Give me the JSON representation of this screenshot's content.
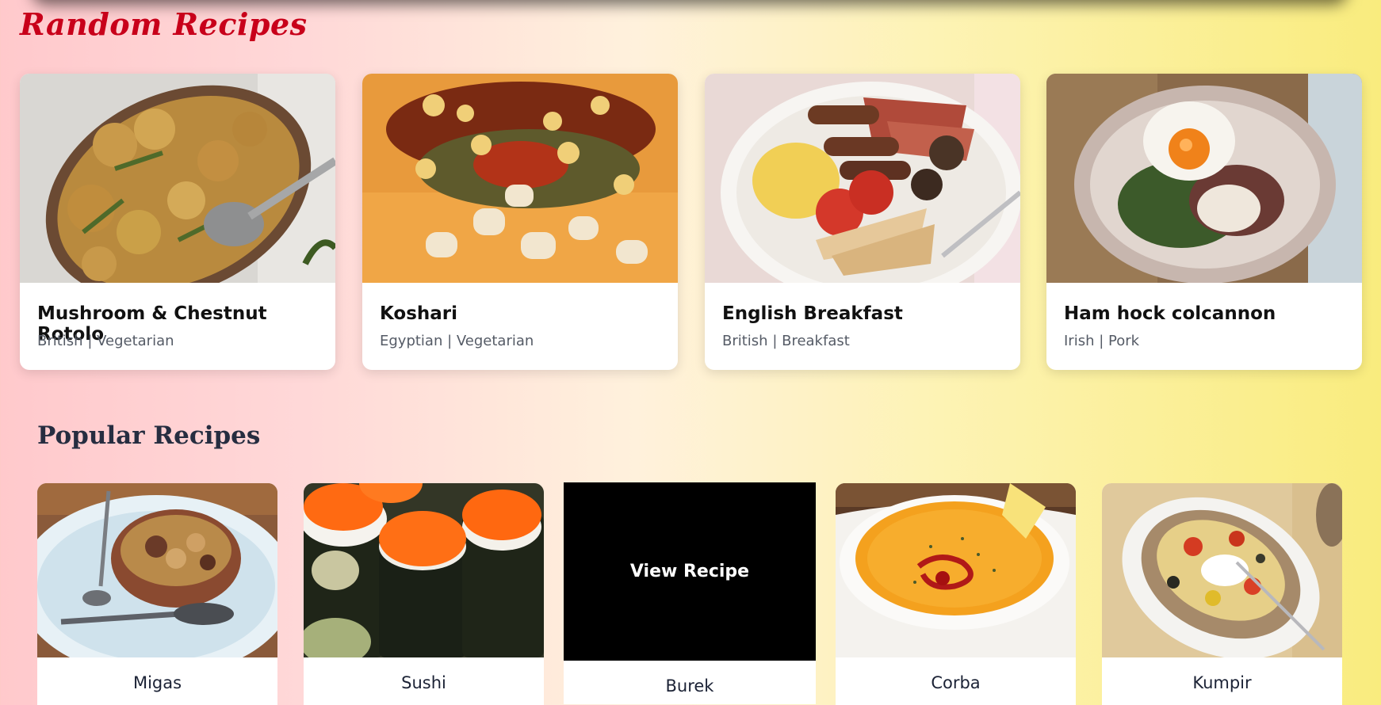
{
  "random": {
    "title": "Random Recipes",
    "items": [
      {
        "name": "Mushroom & Chestnut Rotolo",
        "meta": "British | Vegetarian"
      },
      {
        "name": "Koshari",
        "meta": "Egyptian | Vegetarian"
      },
      {
        "name": "English Breakfast",
        "meta": "British | Breakfast"
      },
      {
        "name": "Ham hock colcannon",
        "meta": "Irish | Pork"
      }
    ]
  },
  "popular": {
    "title": "Popular Recipes",
    "view_label": "View Recipe",
    "items": [
      {
        "name": "Migas"
      },
      {
        "name": "Sushi"
      },
      {
        "name": "Burek"
      },
      {
        "name": "Corba"
      },
      {
        "name": "Kumpir"
      }
    ]
  }
}
